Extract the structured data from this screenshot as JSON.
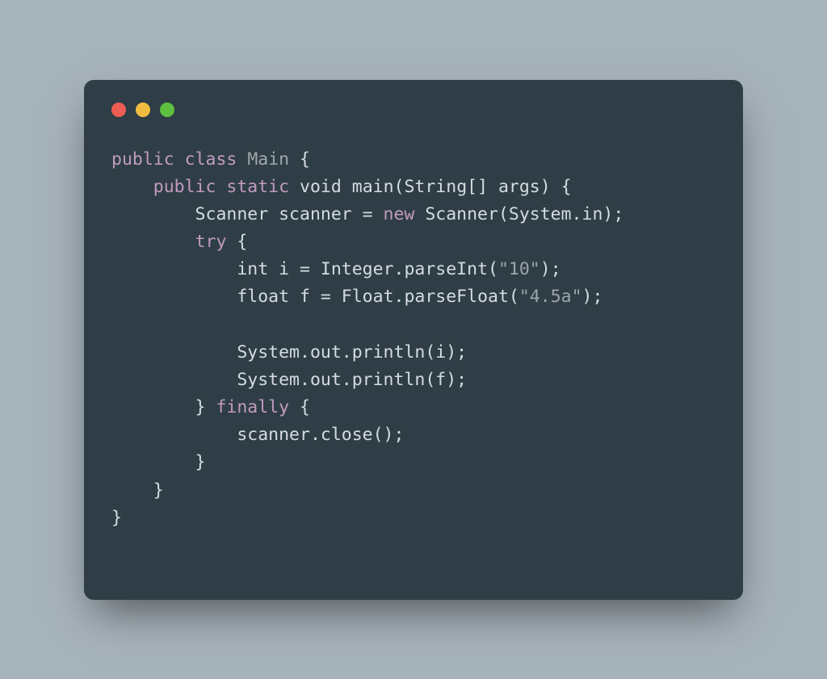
{
  "window": {
    "traffic_lights": {
      "red": "#ee5c54",
      "yellow": "#f1bd41",
      "green": "#5dc03e"
    },
    "background": "#2f3e46"
  },
  "code": {
    "language": "java",
    "tokens": [
      {
        "t": "kw",
        "v": "public"
      },
      {
        "t": "sp",
        "v": " "
      },
      {
        "t": "kw",
        "v": "class"
      },
      {
        "t": "sp",
        "v": " "
      },
      {
        "t": "cls",
        "v": "Main"
      },
      {
        "t": "txt",
        "v": " {"
      },
      {
        "t": "nl"
      },
      {
        "t": "txt",
        "v": "    "
      },
      {
        "t": "kw",
        "v": "public"
      },
      {
        "t": "sp",
        "v": " "
      },
      {
        "t": "kw",
        "v": "static"
      },
      {
        "t": "sp",
        "v": " "
      },
      {
        "t": "type",
        "v": "void"
      },
      {
        "t": "txt",
        "v": " main(String[] args) {"
      },
      {
        "t": "nl"
      },
      {
        "t": "txt",
        "v": "        Scanner scanner = "
      },
      {
        "t": "kw",
        "v": "new"
      },
      {
        "t": "txt",
        "v": " Scanner(System.in);"
      },
      {
        "t": "nl"
      },
      {
        "t": "txt",
        "v": "        "
      },
      {
        "t": "kw",
        "v": "try"
      },
      {
        "t": "txt",
        "v": " {"
      },
      {
        "t": "nl"
      },
      {
        "t": "txt",
        "v": "            "
      },
      {
        "t": "type",
        "v": "int"
      },
      {
        "t": "txt",
        "v": " i = Integer.parseInt("
      },
      {
        "t": "str",
        "v": "\"10\""
      },
      {
        "t": "txt",
        "v": ");"
      },
      {
        "t": "nl"
      },
      {
        "t": "txt",
        "v": "            "
      },
      {
        "t": "type",
        "v": "float"
      },
      {
        "t": "txt",
        "v": " f = Float.parseFloat("
      },
      {
        "t": "str",
        "v": "\"4.5a\""
      },
      {
        "t": "txt",
        "v": ");"
      },
      {
        "t": "nl"
      },
      {
        "t": "nl"
      },
      {
        "t": "txt",
        "v": "            System.out.println(i);"
      },
      {
        "t": "nl"
      },
      {
        "t": "txt",
        "v": "            System.out.println(f);"
      },
      {
        "t": "nl"
      },
      {
        "t": "txt",
        "v": "        } "
      },
      {
        "t": "kw",
        "v": "finally"
      },
      {
        "t": "txt",
        "v": " {"
      },
      {
        "t": "nl"
      },
      {
        "t": "txt",
        "v": "            scanner.close();"
      },
      {
        "t": "nl"
      },
      {
        "t": "txt",
        "v": "        }"
      },
      {
        "t": "nl"
      },
      {
        "t": "txt",
        "v": "    }"
      },
      {
        "t": "nl"
      },
      {
        "t": "txt",
        "v": "}"
      }
    ]
  }
}
